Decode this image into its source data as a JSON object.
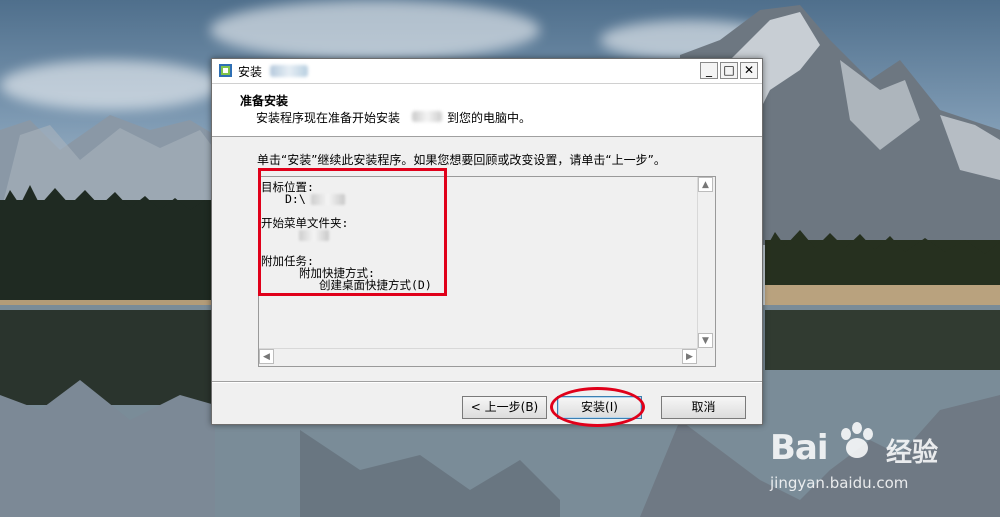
{
  "window": {
    "title": "安装",
    "minimize_glyph": "_",
    "maximize_glyph": "□",
    "close_glyph": "✕"
  },
  "header": {
    "title": "准备安装",
    "subtitle_prefix": "安装程序现在准备开始安装",
    "subtitle_suffix": "到您的电脑中。"
  },
  "instruction": "单击“安装”继续此安装程序。如果您想要回顾或改变设置，请单击“上一步”。",
  "memo": {
    "dest_label": "目标位置:",
    "dest_value": "D:\\",
    "start_menu_label": "开始菜单文件夹:",
    "tasks_label": "附加任务:",
    "tasks_sub": "附加快捷方式:",
    "tasks_item": "创建桌面快捷方式(D)"
  },
  "buttons": {
    "back": "< 上一步(B)",
    "install": "安装(I)",
    "cancel": "取消"
  },
  "watermark": {
    "logo": "Bai",
    "logo_suffix": "经验",
    "url": "jingyan.baidu.com"
  },
  "colors": {
    "annotation": "#e0001a",
    "window_bg": "#f0f0f0",
    "default_button_border": "#3c7fb1"
  }
}
